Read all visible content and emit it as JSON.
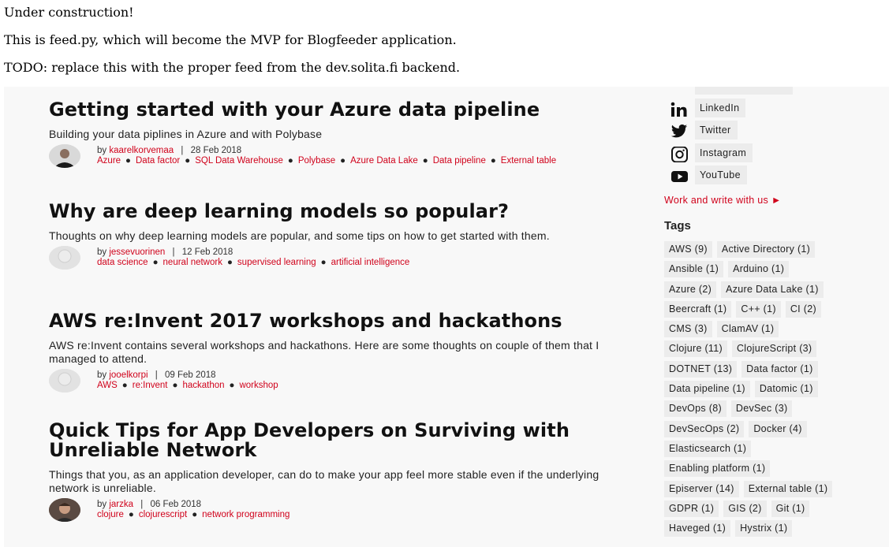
{
  "intro": {
    "line1": "Under construction!",
    "line2": "This is feed.py, which will become the MVP for Blogfeeder application.",
    "line3": "TODO: replace this with the proper feed from the dev.solita.fi backend."
  },
  "accent_color": "#d0021b",
  "posts": [
    {
      "title": "Getting started with your Azure data pipeline",
      "summary": "Building your data piplines in Azure and with Polybase",
      "author": "kaarelkorvemaa",
      "date": "28 Feb 2018",
      "tags": [
        "Azure",
        "Data factor",
        "SQL Data Warehouse",
        "Polybase",
        "Azure Data Lake",
        "Data pipeline",
        "External table"
      ]
    },
    {
      "title": "Why are deep learning models so popular?",
      "summary": "Thoughts on why deep learning models are popular, and some tips on how to get started with them.",
      "author": "jessevuorinen",
      "date": "12 Feb 2018",
      "tags": [
        "data science",
        "neural network",
        "supervised learning",
        "artificial intelligence"
      ]
    },
    {
      "title": "AWS re:Invent 2017 workshops and hackathons",
      "summary": "AWS re:Invent contains several workshops and hackathons. Here are some thoughts on couple of them that I managed to attend.",
      "author": "jooelkorpi",
      "date": "09 Feb 2018",
      "tags": [
        "AWS",
        "re:Invent",
        "hackathon",
        "workshop"
      ]
    },
    {
      "title": "Quick Tips for App Developers on Surviving with Unreliable Network",
      "summary": "Things that you, as an application developer, can do to make your app feel more stable even if the underlying network is unreliable.",
      "author": "jarzka",
      "date": "06 Feb 2018",
      "tags": [
        "clojure",
        "clojurescript",
        "network programming"
      ]
    }
  ],
  "byline": {
    "by": "by",
    "separator": "|"
  },
  "social": [
    {
      "label": "LinkedIn",
      "icon": "linkedin-icon"
    },
    {
      "label": "Twitter",
      "icon": "twitter-icon"
    },
    {
      "label": "Instagram",
      "icon": "instagram-icon"
    },
    {
      "label": "YouTube",
      "icon": "youtube-icon"
    }
  ],
  "work_link": "Work and write with us",
  "tags_heading": "Tags",
  "tag_rows": [
    [
      "AWS (9)",
      "Active Directory (1)"
    ],
    [
      "Ansible (1)",
      "Arduino (1)"
    ],
    [
      "Azure (2)",
      "Azure Data Lake (1)"
    ],
    [
      "Beercraft (1)",
      "C++ (1)",
      "CI (2)"
    ],
    [
      "CMS (3)",
      "ClamAV (1)"
    ],
    [
      "Clojure (11)",
      "ClojureScript (3)"
    ],
    [
      "DOTNET (13)",
      "Data factor (1)"
    ],
    [
      "Data pipeline (1)",
      "Datomic (1)"
    ],
    [
      "DevOps (8)",
      "DevSec (3)"
    ],
    [
      "DevSecOps (2)",
      "Docker (4)"
    ],
    [
      "Elasticsearch (1)"
    ],
    [
      "Enabling platform (1)"
    ],
    [
      "Episerver (14)",
      "External table (1)"
    ],
    [
      "GDPR (1)",
      "GIS (2)",
      "Git (1)"
    ],
    [
      "Haveged (1)",
      "Hystrix (1)"
    ]
  ]
}
